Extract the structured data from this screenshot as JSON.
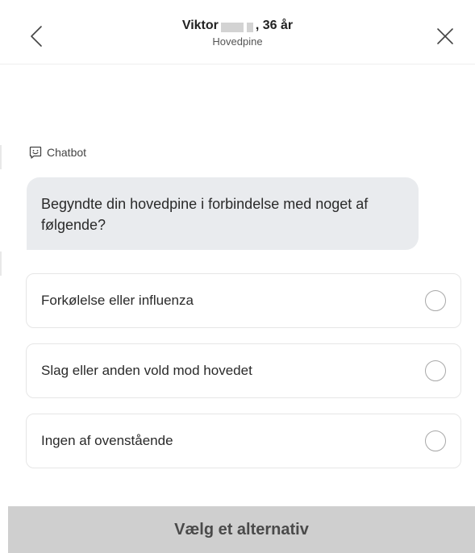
{
  "header": {
    "patient_name": "Viktor",
    "patient_age_suffix": ", 36 år",
    "subtitle": "Hovedpine",
    "back_icon": "chevron-left-icon",
    "close_icon": "close-icon"
  },
  "chat": {
    "sender_label": "Chatbot",
    "sender_icon": "chat-smile-icon",
    "question": "Begyndte din hovedpine i forbindelse med noget af følgende?"
  },
  "options": [
    {
      "label": "Forkølelse eller influenza",
      "selected": false
    },
    {
      "label": "Slag eller anden vold mod hovedet",
      "selected": false
    },
    {
      "label": "Ingen af ovenstående",
      "selected": false
    }
  ],
  "footer": {
    "button_label": "Vælg et alternativ"
  },
  "colors": {
    "bubble_bg": "#e9ebee",
    "button_disabled_bg": "#cfcfcf",
    "border": "#e6e6e6"
  }
}
